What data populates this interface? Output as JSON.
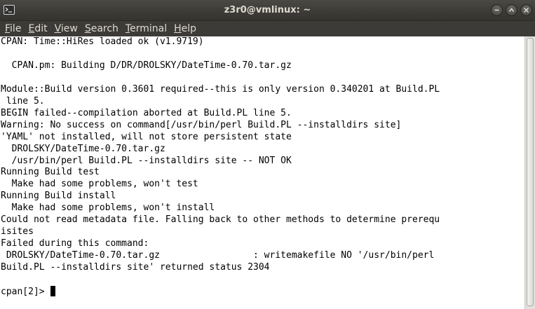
{
  "window": {
    "title": "z3r0@vmlinux: ~",
    "icons": {
      "app": "terminal-icon",
      "minimize": "minimize-icon",
      "maximize": "maximize-icon",
      "close": "close-icon"
    }
  },
  "menubar": {
    "items": [
      {
        "mnemonic": "F",
        "rest": "ile"
      },
      {
        "mnemonic": "E",
        "rest": "dit"
      },
      {
        "mnemonic": "V",
        "rest": "iew"
      },
      {
        "mnemonic": "S",
        "rest": "earch"
      },
      {
        "mnemonic": "T",
        "rest": "erminal"
      },
      {
        "mnemonic": "H",
        "rest": "elp"
      }
    ]
  },
  "terminal": {
    "lines": [
      "CPAN: Time::HiRes loaded ok (v1.9719)",
      "",
      "  CPAN.pm: Building D/DR/DROLSKY/DateTime-0.70.tar.gz",
      "",
      "Module::Build version 0.3601 required--this is only version 0.340201 at Build.PL",
      " line 5.",
      "BEGIN failed--compilation aborted at Build.PL line 5.",
      "Warning: No success on command[/usr/bin/perl Build.PL --installdirs site]",
      "'YAML' not installed, will not store persistent state",
      "  DROLSKY/DateTime-0.70.tar.gz",
      "  /usr/bin/perl Build.PL --installdirs site -- NOT OK",
      "Running Build test",
      "  Make had some problems, won't test",
      "Running Build install",
      "  Make had some problems, won't install",
      "Could not read metadata file. Falling back to other methods to determine prerequ",
      "isites",
      "Failed during this command:",
      " DROLSKY/DateTime-0.70.tar.gz                 : writemakefile NO '/usr/bin/perl",
      "Build.PL --installdirs site' returned status 2304"
    ],
    "prompt": "cpan[2]> "
  },
  "colors": {
    "titlebar": "#3c3b37",
    "title_text": "#dfdbd2",
    "terminal_bg": "#ffffff",
    "terminal_fg": "#000000"
  }
}
